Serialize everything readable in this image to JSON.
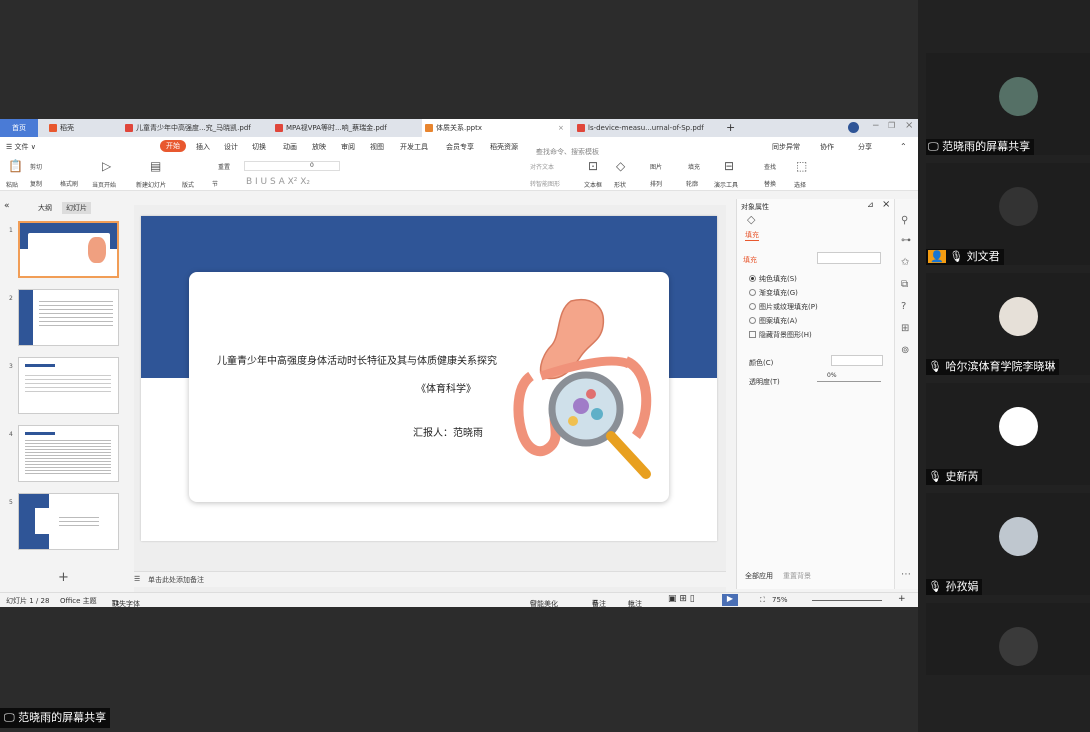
{
  "tabs": {
    "home": "首页",
    "wps": "稻壳",
    "t1": "儿童青少年中高强度...究_马晓凯.pdf",
    "t2": "MPA视VPA等时...响_蔡瑞金.pdf",
    "t3": "体质关系.pptx",
    "t4": "ls-device-measu...urnal-of-Sp.pdf",
    "plus": "+"
  },
  "menu": {
    "file": "☰ 文件 ∨",
    "start": "开始",
    "items": [
      "插入",
      "设计",
      "切换",
      "动画",
      "放映",
      "审阅",
      "视图",
      "开发工具",
      "会员专享",
      "稻壳资源"
    ],
    "search": "查找命令、搜索模板",
    "sync": "同步异常",
    "collab": "协作",
    "share": "分享"
  },
  "ribbon": {
    "paste": "粘贴",
    "cut": "剪切",
    "copy": "复制",
    "format": "格式刷",
    "from_current": "当页开始",
    "new_slide": "新建幻灯片",
    "layout": "版式",
    "reset": "重置",
    "section": "节",
    "font_size": "0",
    "textbox": "文本框",
    "shape": "形状",
    "picture": "图片",
    "fill": "填充",
    "arrange": "排列",
    "outline": "轮廓",
    "present_tools": "演示工具",
    "find": "查找",
    "replace": "替换",
    "select": "选择",
    "align_text": "对齐文本",
    "smart_art": "转智能图形"
  },
  "left_pane": {
    "outline_tab": "大纲",
    "slides_tab": "幻灯片",
    "add": "+",
    "numbers": [
      "1",
      "2",
      "3",
      "4",
      "5"
    ]
  },
  "slide": {
    "title": "儿童青少年中高强度身体活动时长特征及其与体质健康关系探究",
    "subtitle": "《体育科学》",
    "reporter": "汇报人：范晓雨"
  },
  "notes_placeholder": "单击此处添加备注",
  "props_pane": {
    "header": "对象属性",
    "tab": "填充",
    "section": "填充",
    "options": [
      "纯色填充(S)",
      "渐变填充(G)",
      "图片或纹理填充(P)",
      "图案填充(A)"
    ],
    "hide_bg": "隐藏背景图形(H)",
    "color_label": "颜色(C)",
    "transparency_label": "透明度(T)",
    "transparency_value": "0%",
    "apply_all": "全部应用",
    "reset_bg": "重置背景"
  },
  "status": {
    "slide_info": "幻灯片 1 / 28",
    "theme": "Office 主题",
    "missing_font": "缺失字体",
    "beautify": "智能美化",
    "notes": "备注",
    "comments": "批注",
    "zoom": "75%"
  },
  "participants": [
    {
      "name": "范晓雨的屏幕共享",
      "kind": "screen"
    },
    {
      "name": "刘文君",
      "kind": "person"
    },
    {
      "name": "哈尔滨体育学院李晓琳",
      "kind": "person"
    },
    {
      "name": "史新芮",
      "kind": "person"
    },
    {
      "name": "孙孜娟",
      "kind": "person"
    },
    {
      "name": "",
      "kind": "person"
    }
  ],
  "bottom_label": "范晓雨的屏幕共享",
  "colors": {
    "accent": "#e8582f",
    "slide_band": "#2f5597",
    "home_tab": "#4a7bd6",
    "thumb_selected": "#f19d56"
  }
}
